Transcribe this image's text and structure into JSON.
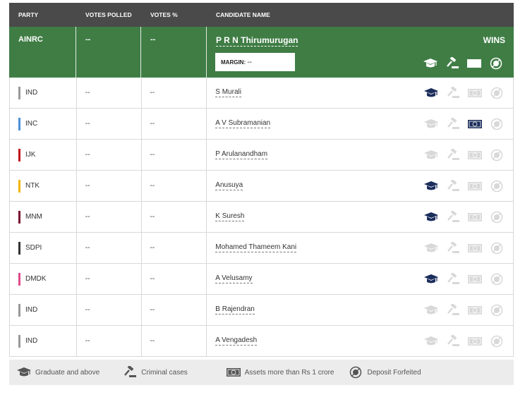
{
  "header": {
    "party": "PARTY",
    "votes_polled": "VOTES POLLED",
    "votes_pct": "VOTES %",
    "candidate": "CANDIDATE NAME"
  },
  "winner": {
    "party": "AINRC",
    "votes_polled": "--",
    "votes_pct": "--",
    "name": "P R N Thirumurugan",
    "status": "WINS",
    "margin_label": "MARGIN:",
    "margin_value": "--"
  },
  "rows": [
    {
      "party": "IND",
      "color": "#999999",
      "votes": "--",
      "pct": "--",
      "name": "S Murali",
      "graduate": true,
      "criminal": false,
      "assets": false,
      "deposit": false
    },
    {
      "party": "INC",
      "color": "#4a90d9",
      "votes": "--",
      "pct": "--",
      "name": "A V Subramanian",
      "graduate": false,
      "criminal": false,
      "assets": true,
      "deposit": false
    },
    {
      "party": "IJK",
      "color": "#c0101a",
      "votes": "--",
      "pct": "--",
      "name": "P Arulanandham",
      "graduate": false,
      "criminal": false,
      "assets": false,
      "deposit": false
    },
    {
      "party": "NTK",
      "color": "#f2b600",
      "votes": "--",
      "pct": "--",
      "name": "Anusuya",
      "graduate": true,
      "criminal": false,
      "assets": false,
      "deposit": false
    },
    {
      "party": "MNM",
      "color": "#7a1030",
      "votes": "--",
      "pct": "--",
      "name": "K Suresh",
      "graduate": true,
      "criminal": false,
      "assets": false,
      "deposit": false
    },
    {
      "party": "SDPI",
      "color": "#333333",
      "votes": "--",
      "pct": "--",
      "name": "Mohamed Thameem Kani",
      "graduate": false,
      "criminal": false,
      "assets": false,
      "deposit": false
    },
    {
      "party": "DMDK",
      "color": "#e04a8a",
      "votes": "--",
      "pct": "--",
      "name": "A Velusamy",
      "graduate": true,
      "criminal": false,
      "assets": false,
      "deposit": false
    },
    {
      "party": "IND",
      "color": "#999999",
      "votes": "--",
      "pct": "--",
      "name": "B Rajendran",
      "graduate": false,
      "criminal": false,
      "assets": false,
      "deposit": false
    },
    {
      "party": "IND",
      "color": "#999999",
      "votes": "--",
      "pct": "--",
      "name": "A Vengadesh",
      "graduate": false,
      "criminal": false,
      "assets": false,
      "deposit": false
    }
  ],
  "legend": {
    "graduate": "Graduate and above",
    "criminal": "Criminal cases",
    "assets": "Assets more than Rs 1 crore",
    "deposit": "Deposit Forfeited"
  },
  "colors": {
    "header_bg": "#4a4a4a",
    "winner_bg": "#3f7d45",
    "icon_active": "#1b2d5b",
    "icon_inactive": "#d8d8d8"
  },
  "icons": [
    "graduation-cap-icon",
    "gavel-icon",
    "banknote-icon",
    "deposit-forfeited-icon"
  ]
}
